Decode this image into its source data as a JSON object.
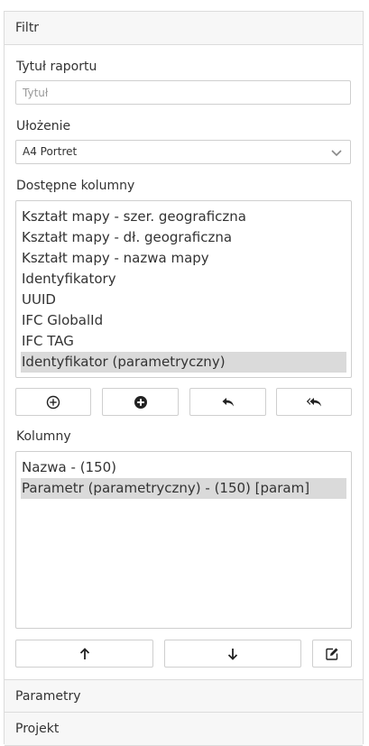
{
  "sections": {
    "filter": "Filtr",
    "parameters": "Parametry",
    "project": "Projekt"
  },
  "report_title": {
    "label": "Tytuł raportu",
    "placeholder": "Tytuł",
    "value": ""
  },
  "layout": {
    "label": "Ułożenie",
    "selected": "A4 Portret"
  },
  "available_columns": {
    "label": "Dostępne kolumny",
    "items": [
      "Kształt mapy - szer. geograficzna",
      "Kształt mapy - dł. geograficzna",
      "Kształt mapy - nazwa mapy",
      "Identyfikatory",
      "UUID",
      "IFC GlobalId",
      "IFC TAG",
      "Identyfikator (parametryczny)"
    ],
    "selected_index": 7,
    "buttons": [
      "add-one-icon",
      "add-all-icon",
      "remove-one-icon",
      "remove-all-icon"
    ]
  },
  "columns": {
    "label": "Kolumny",
    "items": [
      "Nazwa - (150)",
      "Parametr (parametryczny) - (150) [param]"
    ],
    "selected_index": 1,
    "buttons": [
      "arrow-up-icon",
      "arrow-down-icon",
      "edit-icon"
    ]
  }
}
